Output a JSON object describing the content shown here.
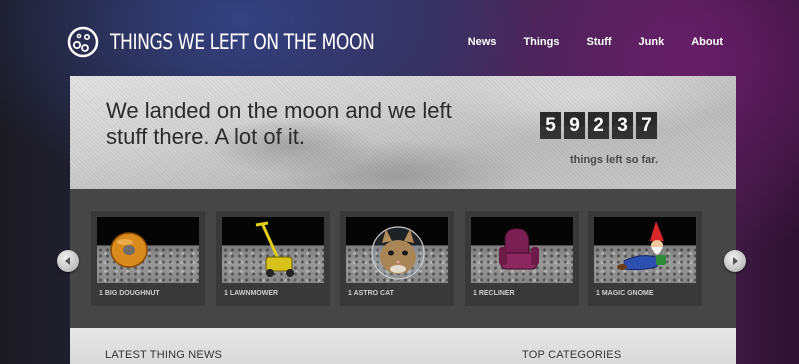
{
  "site": {
    "title": "THINGS WE LEFT ON THE MOON",
    "logo_icon": "moon-crater-icon"
  },
  "nav": {
    "items": [
      {
        "label": "News"
      },
      {
        "label": "Things"
      },
      {
        "label": "Stuff"
      },
      {
        "label": "Junk"
      },
      {
        "label": "About"
      }
    ]
  },
  "hero": {
    "headline": "We landed on the moon and we left stuff there. A lot of it.",
    "counter_digits": [
      "5",
      "9",
      "2",
      "3",
      "7"
    ],
    "counter_label": "things left so far."
  },
  "carousel": {
    "prev_icon": "chevron-left-icon",
    "next_icon": "chevron-right-icon",
    "items": [
      {
        "label": "1 BIG DOUGHNUT",
        "icon": "doughnut-icon"
      },
      {
        "label": "1 LAWNMOWER",
        "icon": "lawnmower-icon"
      },
      {
        "label": "1 ASTRO CAT",
        "icon": "astronaut-cat-icon"
      },
      {
        "label": "1 RECLINER",
        "icon": "recliner-icon"
      },
      {
        "label": "1 MAGIC GNOME",
        "icon": "gnome-icon"
      }
    ]
  },
  "sections": {
    "news_heading": "LATEST THING NEWS",
    "categories_heading": "TOP CATEGORIES"
  }
}
